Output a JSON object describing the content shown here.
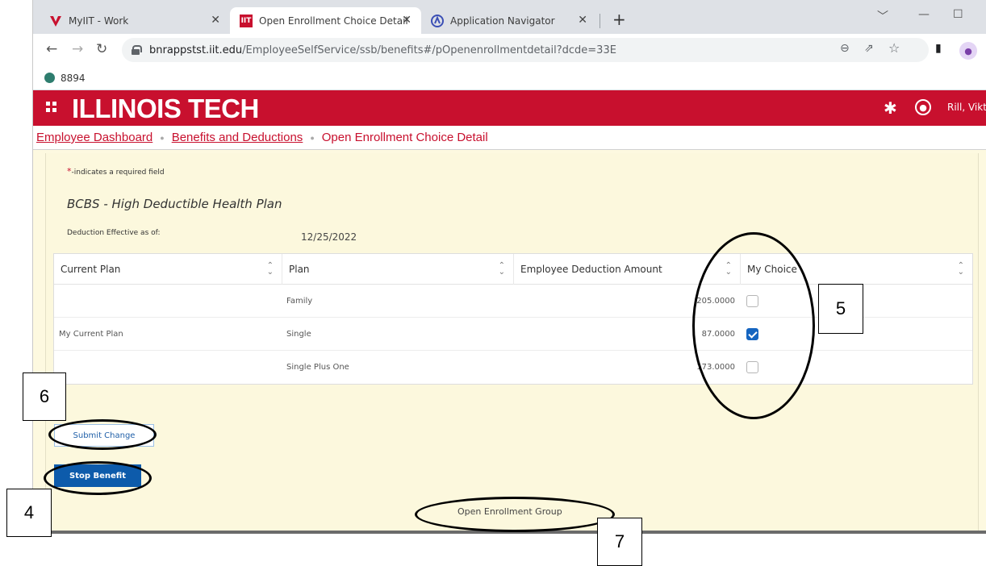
{
  "browser": {
    "tabs": [
      {
        "title": "MyIIT - Work",
        "favicon": "myiit-v-icon",
        "active": false
      },
      {
        "title": "Open Enrollment Choice Detail",
        "favicon": "iit-icon",
        "active": true
      },
      {
        "title": "Application Navigator",
        "favicon": "navigator-icon",
        "active": false
      }
    ],
    "new_tab": "+",
    "url_host": "bnrappstst.iit.edu",
    "url_path": "/EmployeeSelfService/ssb/benefits#/pOpenenrollmentdetail?dcde=33E",
    "bookmark": "8894",
    "favicon_iit": "IIT"
  },
  "header": {
    "brand": "ILLINOIS TECH",
    "user_name": "Rill, Vikto",
    "brand_color": "#c8102e"
  },
  "breadcrumb": {
    "items": [
      "Employee Dashboard",
      "Benefits and Deductions"
    ],
    "current": "Open Enrollment Choice Detail"
  },
  "form": {
    "required_marker": "*",
    "required_note": "-indicates a required field",
    "plan_title": "BCBS - High Deductible Health Plan",
    "effective_label": "Deduction Effective as of:",
    "effective_value": "12/25/2022"
  },
  "table": {
    "columns": [
      "Current Plan",
      "Plan",
      "Employee Deduction Amount",
      "My Choice"
    ],
    "rows": [
      {
        "current_plan": "",
        "plan": "Family",
        "amount": "205.0000",
        "my_choice": false
      },
      {
        "current_plan": "My Current Plan",
        "plan": "Single",
        "amount": "87.0000",
        "my_choice": true
      },
      {
        "current_plan": "",
        "plan": "Single Plus One",
        "amount": "173.0000",
        "my_choice": false
      }
    ]
  },
  "actions": {
    "submit": "Submit Change",
    "stop": "Stop Benefit",
    "footer_link": "Open Enrollment Group"
  },
  "annotations": {
    "labels": [
      "4",
      "5",
      "6",
      "7"
    ]
  }
}
